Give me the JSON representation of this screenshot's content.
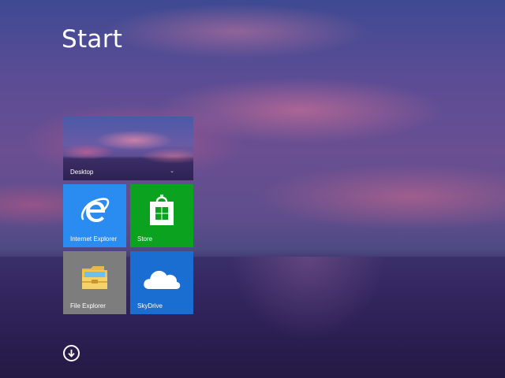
{
  "screen": {
    "title": "Start"
  },
  "tiles": [
    {
      "id": "desktop",
      "label": "Desktop",
      "icon": "landscape-thumbnail",
      "color": "#5a4c92"
    },
    {
      "id": "internet-explorer",
      "label": "Internet Explorer",
      "icon": "internet-explorer-icon",
      "color": "#2a8bf0"
    },
    {
      "id": "store",
      "label": "Store",
      "icon": "store-bag-icon",
      "color": "#0aa21e"
    },
    {
      "id": "file-explorer",
      "label": "File Explorer",
      "icon": "folder-icon",
      "color": "#7d7d7d"
    },
    {
      "id": "skydrive",
      "label": "SkyDrive",
      "icon": "cloud-icon",
      "color": "#1b6ed1"
    }
  ],
  "apps_button": {
    "icon": "arrow-down-circle-icon"
  }
}
